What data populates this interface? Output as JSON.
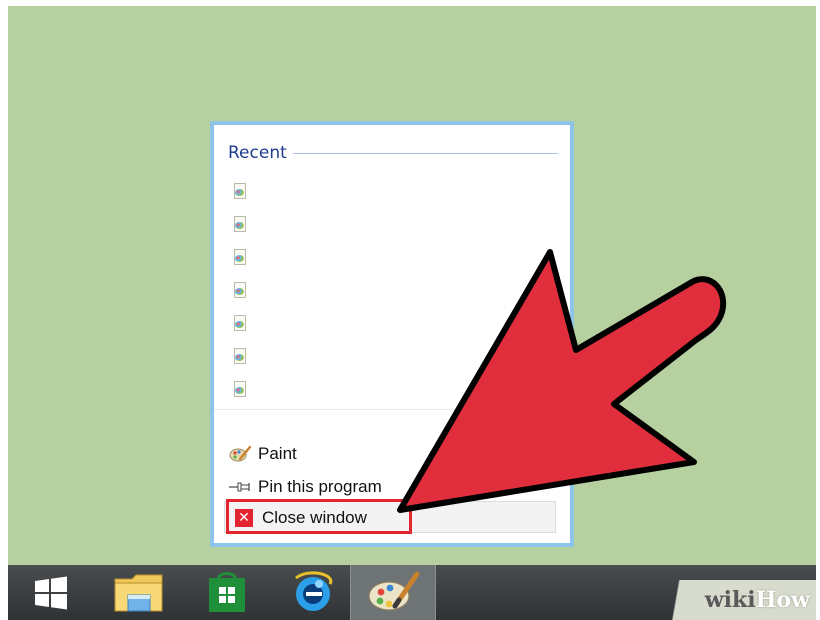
{
  "jumplist": {
    "section_title": "Recent",
    "recent_items": [
      {
        "icon": "paint-file-icon"
      },
      {
        "icon": "paint-file-icon"
      },
      {
        "icon": "paint-file-icon"
      },
      {
        "icon": "paint-file-icon"
      },
      {
        "icon": "paint-file-icon"
      },
      {
        "icon": "paint-file-icon"
      },
      {
        "icon": "paint-file-icon"
      }
    ],
    "tasks": {
      "app_name": "Paint",
      "pin_label": "Pin this program",
      "close_label": "Close window"
    }
  },
  "taskbar": {
    "buttons": [
      {
        "name": "windows-start-icon"
      },
      {
        "name": "file-explorer-icon"
      },
      {
        "name": "store-icon"
      },
      {
        "name": "internet-explorer-icon"
      },
      {
        "name": "paint-icon",
        "active": true
      }
    ]
  },
  "watermark": {
    "part1": "wiki",
    "part2": "How"
  },
  "colors": {
    "desktop": "#b6d19f",
    "jumplist_border": "#8cc5e8",
    "highlight": "#e2252f",
    "arrow_fill": "#e02e3d"
  }
}
